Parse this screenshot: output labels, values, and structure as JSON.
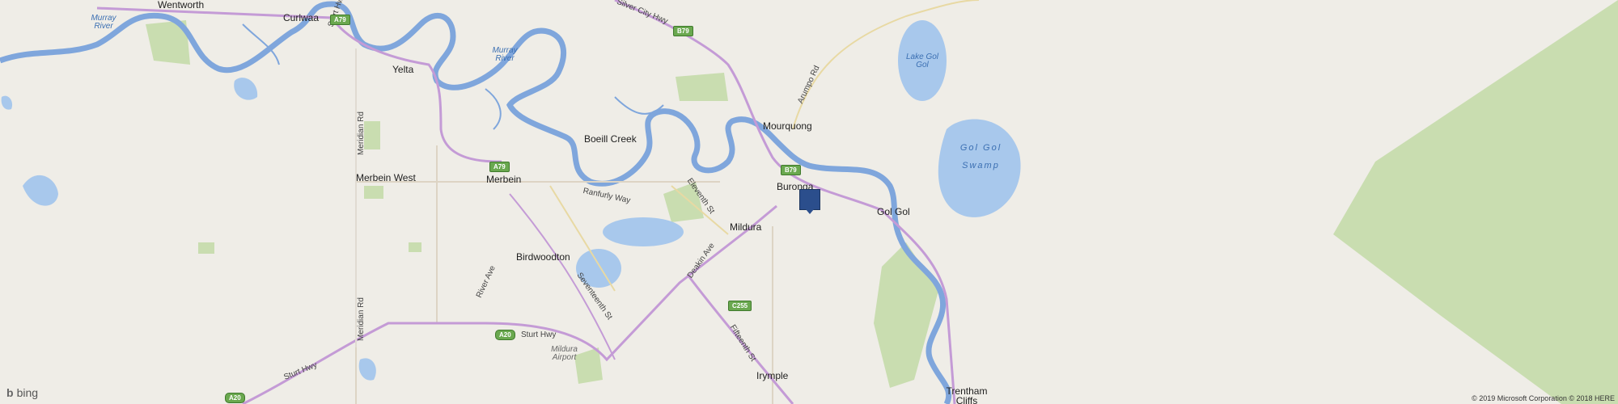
{
  "towns": {
    "wentworth": "Wentworth",
    "curlwaa": "Curlwaa",
    "yelta": "Yelta",
    "boeill_creek": "Boeill Creek",
    "mourquong": "Mourquong",
    "buronga": "Buronga",
    "merbein_west": "Merbein West",
    "merbein": "Merbein",
    "mildura": "Mildura",
    "gol_gol": "Gol Gol",
    "birdwoodton": "Birdwoodton",
    "irymple": "Irymple",
    "trentham_cliffs": "Trentham Cliffs"
  },
  "water": {
    "murray_river_1": "Murray River",
    "murray_river_2": "Murray River",
    "lake_gol_gol": "Lake Gol Gol",
    "gol_gol_swamp": "Gol Gol Swamp"
  },
  "roads": {
    "silver_city_hwy": "Silver City Hwy",
    "arumpo_rd": "Arumpo Rd",
    "ranfurly_way": "Ranfurly Way",
    "eleventh_st": "Eleventh St",
    "deakin_ave": "Deakin Ave",
    "seventeenth_st": "Seventeenth St",
    "fifteenth_st": "Fifteenth St",
    "river_ave": "River Ave",
    "meridian_rd_1": "Meridian Rd",
    "meridian_rd_2": "Meridian Rd",
    "sturt_hwy_1": "Sturt Hwy",
    "sturt_hwy_2": "Sturt Hwy",
    "sturt_hwy_3": "Sturt Hwy"
  },
  "shields": {
    "b79_top": "B79",
    "b79_buronga": "B79",
    "a79_curlwaa": "A79",
    "a79_merbein": "A79",
    "c255": "C255",
    "a20_sturt": "A20",
    "a20_left": "A20"
  },
  "airport": "Mildura Airport",
  "footer": {
    "brand": "bing",
    "copyright": "© 2019 Microsoft Corporation © 2018 HERE"
  },
  "colors": {
    "land": "#efede7",
    "water": "#a8c8ec",
    "river": "#7fa6dc",
    "park": "#c9ddb0",
    "highway": "#c49bd6",
    "local_road": "#ddd4c4",
    "marker": "#2b4e8c"
  }
}
